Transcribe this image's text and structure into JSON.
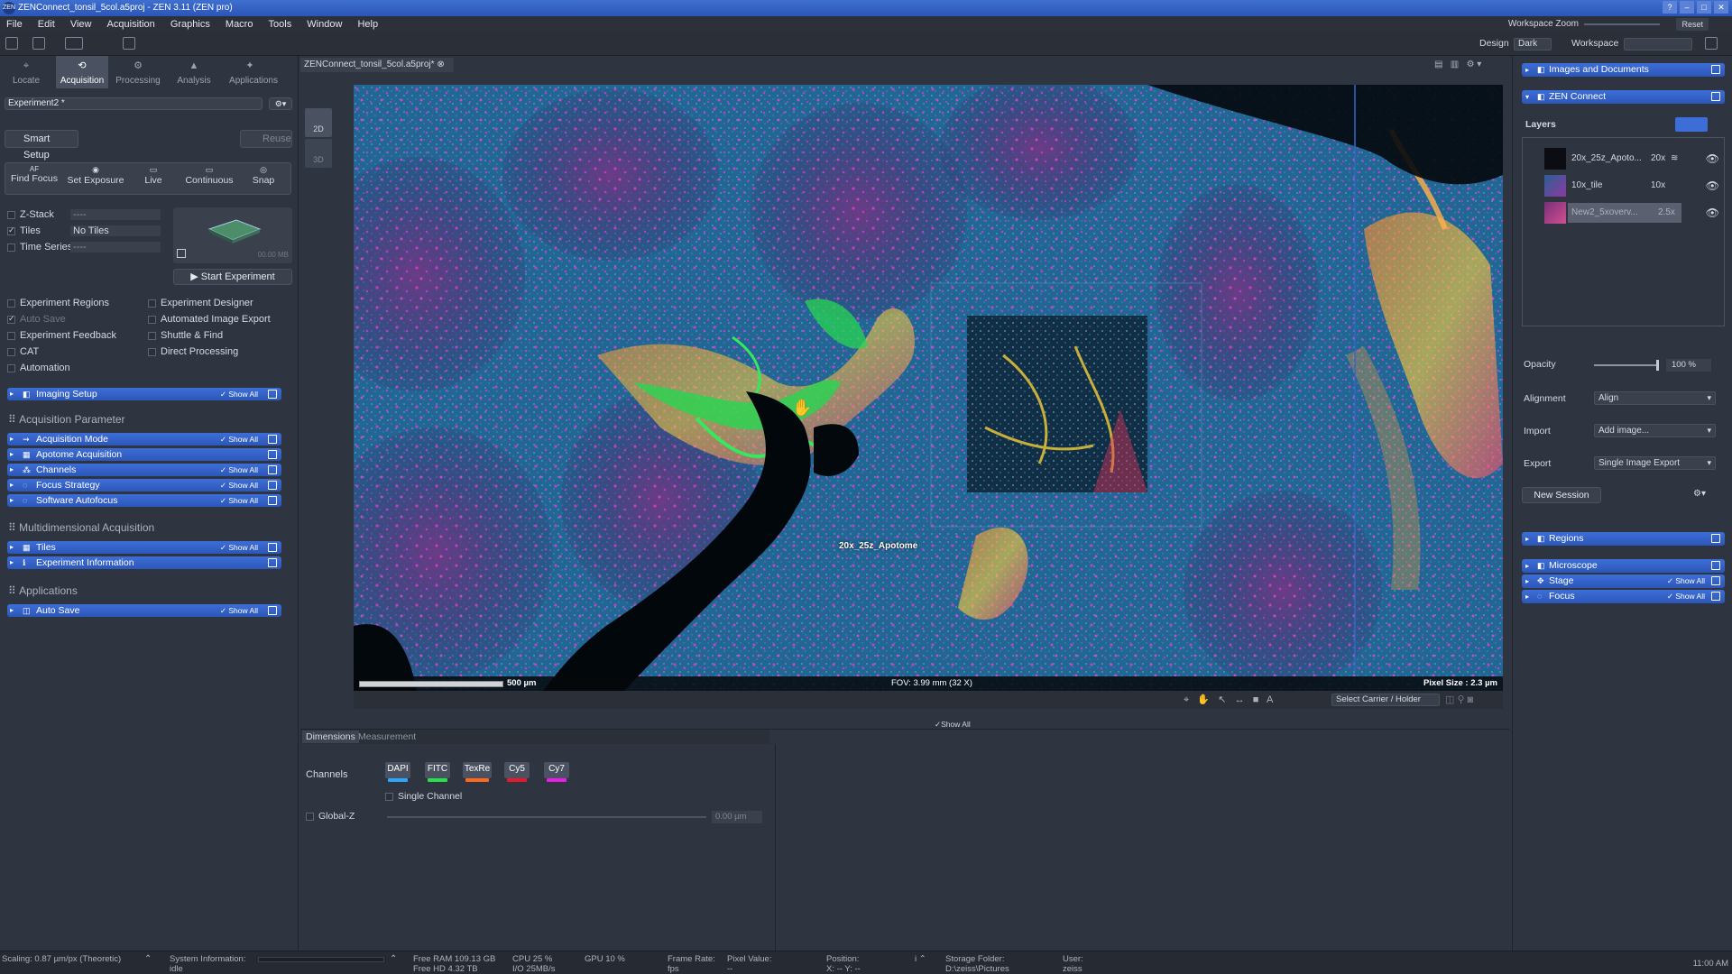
{
  "window": {
    "title": "ZENConnect_tonsil_5col.a5proj - ZEN 3.11 (ZEN pro)",
    "app_icon": "ZEN",
    "buttons": [
      "?",
      "–",
      "□",
      "✕"
    ]
  },
  "menu": {
    "items": [
      "File",
      "Edit",
      "View",
      "Acquisition",
      "Graphics",
      "Macro",
      "Tools",
      "Window",
      "Help"
    ],
    "workspace_zoom": "Workspace Zoom",
    "reset": "Reset"
  },
  "toolbar": {
    "design_label": "Design",
    "design_value": "Dark",
    "workspace_label": "Workspace"
  },
  "left": {
    "tabs": [
      "Locate",
      "Acquisition",
      "Processing",
      "Analysis",
      "Applications"
    ],
    "experiment": "Experiment2 *",
    "smart_setup": "Smart Setup",
    "reuse": "Reuse",
    "actions": [
      {
        "label": "Find Focus",
        "icon": "AF"
      },
      {
        "label": "Set Exposure",
        "icon": "◉"
      },
      {
        "label": "Live",
        "icon": "▭"
      },
      {
        "label": "Continuous",
        "icon": "▭"
      },
      {
        "label": "Snap",
        "icon": "◎"
      }
    ],
    "dims": [
      {
        "label": "Z-Stack",
        "value": "----",
        "on": false
      },
      {
        "label": "Tiles",
        "value": "No Tiles",
        "on": true
      },
      {
        "label": "Time Series",
        "value": "----",
        "on": false
      }
    ],
    "preview_size": "00.00 MB",
    "start_experiment": "Start Experiment",
    "options_left": [
      "Experiment Regions",
      "Auto Save",
      "Experiment Feedback",
      "CAT",
      "Automation"
    ],
    "options_right": [
      "Experiment Designer",
      "Automated Image Export",
      "Shuttle & Find",
      "Direct Processing"
    ],
    "imaging_setup": "Imaging Setup",
    "show_all": "Show All",
    "sec_acq": "Acquisition Parameter",
    "acq_items": [
      "Acquisition Mode",
      "Apotome Acquisition",
      "Channels",
      "Focus Strategy",
      "Software Autofocus"
    ],
    "sec_multi": "Multidimensional Acquisition",
    "multi_items": [
      "Tiles",
      "Experiment Information"
    ],
    "sec_apps": "Applications",
    "app_items": [
      "Auto Save"
    ]
  },
  "doc": {
    "tab": "ZENConnect_tonsil_5col.a5proj*",
    "view_2d": "2D",
    "view_3d": "3D",
    "roi_label": "20x_25z_Apotome",
    "scale": "500 µm",
    "fov": "FOV: 3.99 mm (32 X)",
    "pixel_size": "Pixel Size : 2.3 µm",
    "carrier": "Select Carrier / Holder",
    "show_all": "Show All"
  },
  "bottom": {
    "tabs": [
      "Dimensions",
      "Measurement"
    ],
    "channels_label": "Channels",
    "channels": [
      {
        "name": "DAPI",
        "color": "#2aa8ff"
      },
      {
        "name": "FITC",
        "color": "#28e04a"
      },
      {
        "name": "TexRe",
        "color": "#ff6a1a"
      },
      {
        "name": "Cy5",
        "color": "#e8182a"
      },
      {
        "name": "Cy7",
        "color": "#e81ee8"
      }
    ],
    "single_channel": "Single Channel",
    "global_z": "Global-Z",
    "z_value": "0.00 µm"
  },
  "right": {
    "images_docs": "Images and Documents",
    "zen_connect": "ZEN Connect",
    "layers_title": "Layers",
    "layers": [
      {
        "name": "20x_25z_Apoto...",
        "zoom": "20x"
      },
      {
        "name": "10x_tile",
        "zoom": "10x"
      },
      {
        "name": "New2_5xoverv...",
        "zoom": "2.5x"
      }
    ],
    "opacity_label": "Opacity",
    "opacity_value": "100 %",
    "opacity": 1.0,
    "alignment_label": "Alignment",
    "alignment_value": "Align",
    "import_label": "Import",
    "import_value": "Add image...",
    "export_label": "Export",
    "export_value": "Single Image Export",
    "new_session": "New Session",
    "regions": "Regions",
    "microscope": "Microscope",
    "stage": "Stage",
    "focus": "Focus",
    "show_all": "Show All"
  },
  "status": {
    "scaling": "Scaling: 0.87 µm/px (Theoretic)",
    "sysinfo_label": "System Information:",
    "sysinfo_value": "idle",
    "free_ram": "Free RAM  109.13 GB",
    "free_hd": "Free HD    4.32 TB",
    "cpu": "CPU  25 %",
    "io": "I/O  25MB/s",
    "gpu": "GPU  10 %",
    "frame_rate": "Frame Rate:",
    "fps": "fps",
    "pixel_value": "Pixel Value:",
    "pixel_dash": "--",
    "position": "Position:",
    "pos_xy": "X: --    Y: --",
    "storage_label": "Storage Folder:",
    "storage_path": "D:\\zeiss\\Pictures",
    "user_label": "User:",
    "user": "zeiss",
    "time": "11:00 AM"
  }
}
